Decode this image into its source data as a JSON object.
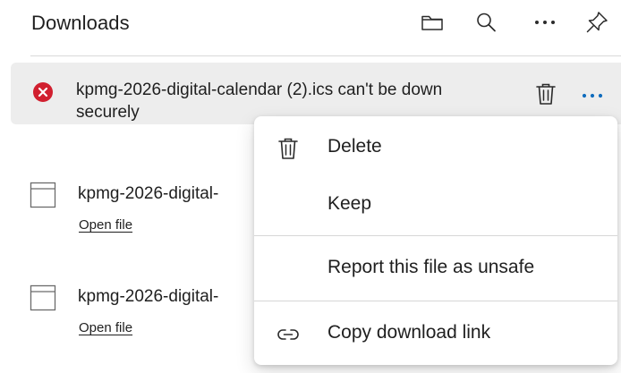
{
  "header": {
    "title": "Downloads",
    "icons": [
      "folder-icon",
      "search-icon",
      "more-icon",
      "pin-icon"
    ]
  },
  "failed_item": {
    "line1": "kpmg-2026-digital-calendar (2).ics can't be down",
    "line2": "securely",
    "status_color": "#d11f2f",
    "icons": [
      "error-icon",
      "trash-icon",
      "more-icon"
    ],
    "accent": "#0f6cbd"
  },
  "downloads": [
    {
      "name": "kpmg-2026-digital-",
      "link": "Open file"
    },
    {
      "name": "kpmg-2026-digital-",
      "link": "Open file"
    }
  ],
  "context_menu": {
    "items": [
      {
        "label": "Delete",
        "icon": "trash-icon"
      },
      {
        "label": "Keep",
        "icon": ""
      },
      {
        "label": "Report this file as unsafe",
        "icon": ""
      },
      {
        "label": "Copy download link",
        "icon": "link-icon"
      }
    ]
  }
}
